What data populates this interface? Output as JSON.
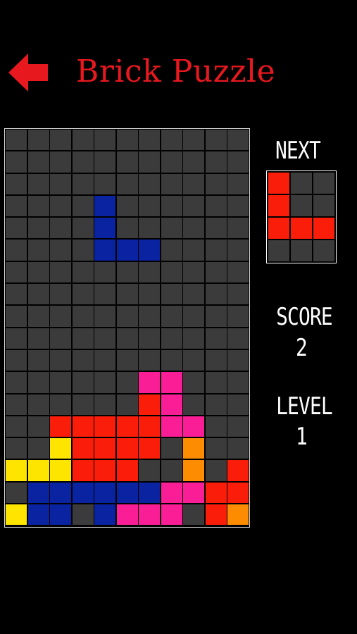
{
  "header": {
    "title": "Brick Puzzle",
    "back_icon": "arrow-left-icon",
    "accent": "#e8181f"
  },
  "side": {
    "next_label": "NEXT",
    "score_label": "SCORE",
    "score_value": "2",
    "level_label": "LEVEL",
    "level_value": "1"
  },
  "colors": {
    "empty": "#3b3b3b",
    "R": "#fa1e0a",
    "Y": "#fde500",
    "B": "#0a23a0",
    "P": "#fa1e96",
    "O": "#fe8c00"
  },
  "board": {
    "columns": 11,
    "rows": [
      "...........",
      "...........",
      "...........",
      "....B......",
      "....B......",
      "....BBB....",
      "...........",
      "...........",
      "...........",
      "...........",
      "...........",
      "......PP...",
      "......RP...",
      "..RRRRRPP..",
      "..YRRRR.O..",
      "YYYRRR..O.R",
      ".BBBBBBPPRR",
      "YBB.BPPP.RO"
    ]
  },
  "next_piece": {
    "columns": 3,
    "rows": [
      "R..",
      "R..",
      "RRR",
      "..."
    ]
  }
}
